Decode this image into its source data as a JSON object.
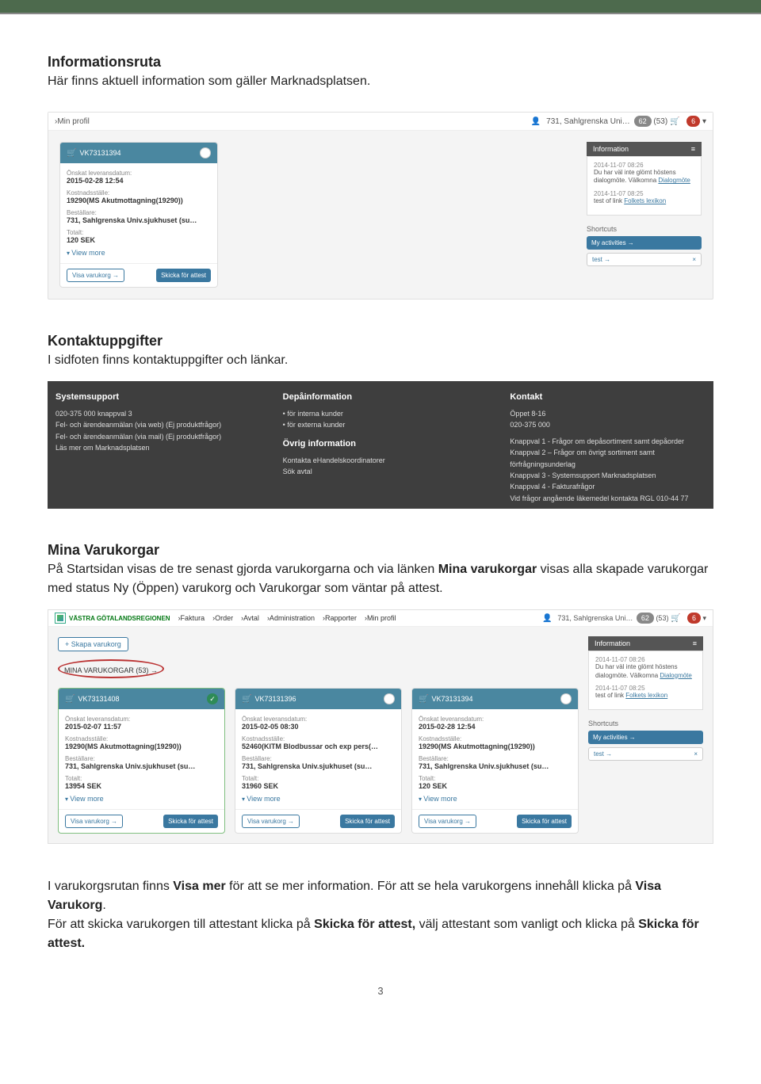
{
  "doc": {
    "h1": "Informationsruta",
    "p1": "Här finns aktuell information som gäller Marknadsplatsen.",
    "h2": "Kontaktuppgifter",
    "p2": "I sidfoten finns kontaktuppgifter och länkar.",
    "h3": "Mina Varukorgar",
    "p3a": "På Startsidan visas de tre senast gjorda varukorgarna och via länken ",
    "p3b": "Mina varukorgar",
    "p3c": " visas alla skapade varukorgar med status Ny (Öppen) varukorg och Varukorgar som väntar på attest.",
    "p4a": "I varukorgsrutan finns ",
    "p4b": "Visa mer",
    "p4c": " för att se mer information. För att se hela varukorgens innehåll klicka på ",
    "p4d": "Visa Varukorg",
    "p4e": ".",
    "p5a": "För att skicka varukorgen till attestant klicka på ",
    "p5b": "Skicka för attest,",
    "p5c": " välj attestant som vanligt och klicka på ",
    "p5d": "Skicka för attest.",
    "pagenum": "3"
  },
  "header": {
    "profile_tab": "›Min profil",
    "user": "731, Sahlgrenska Uni…",
    "badge1": "62",
    "count1": "(53)",
    "badge2": "6"
  },
  "card1": {
    "id": "VK73131394",
    "status": "open",
    "k1": "Önskat leveransdatum:",
    "v1": "2015-02-28 12:54",
    "k2": "Kostnadsställe:",
    "v2": "19290(MS Akutmottagning(19290))",
    "k3": "Beställare:",
    "v3": "731, Sahlgrenska Univ.sjukhuset (su…",
    "k4": "Totalt:",
    "v4": "120 SEK",
    "view_more": "View more",
    "visa": "Visa varukorg →",
    "skicka": "Skicka för attest"
  },
  "info": {
    "title": "Information",
    "icon": "≡",
    "date1": "2014-11-07 08:26",
    "txt1a": "Du har väl inte glömt höstens dialogmöte. Välkomna ",
    "txt1b": "Dialogmöte",
    "date2": "2014-11-07 08:25",
    "txt2a": "test of link ",
    "txt2b": "Folkets lexikon"
  },
  "shortcuts": {
    "title": "Shortcuts",
    "btn1": "My activities →",
    "btn2": "test →",
    "close": "×"
  },
  "footer": {
    "c1h": "Systemsupport",
    "c1l1": "020-375 000 knappval 3",
    "c1l2": "Fel- och ärendeanmälan (via web) (Ej produktfrågor)",
    "c1l3": "Fel- och ärendeanmälan (via mail) (Ej produktfrågor)",
    "c1l4": "Läs mer om Marknadsplatsen",
    "c2h": "Depåinformation",
    "c2l1": "för interna kunder",
    "c2l2": "för externa kunder",
    "c2h2": "Övrig information",
    "c2l3": "Kontakta eHandelskoordinatorer",
    "c2l4": "Sök avtal",
    "c3h": "Kontakt",
    "c3l1": "Öppet 8-16",
    "c3l2": "020-375 000",
    "c3l3": "Knappval 1 - Frågor om depåsortiment samt depåorder",
    "c3l4": "Knappval 2 – Frågor om övrigt sortiment samt förfrågningsunderlag",
    "c3l5": "Knappval 3 - Systemsupport Marknadsplatsen",
    "c3l6": "Knappval 4 - Fakturafrågor",
    "c3l7": "Vid frågor angående läkemedel kontakta RGL 010-44 77"
  },
  "nav": {
    "logo": "VÄSTRA GÖTALANDSREGIONEN",
    "tabs": [
      "›Faktura",
      "›Order",
      "›Avtal",
      "›Administration",
      "›Rapporter",
      "›Min profil"
    ]
  },
  "ss2": {
    "plus": "+ Skapa varukorg",
    "mina": "MINA VARUKORGAR (53) →"
  },
  "cards2": [
    {
      "id": "VK73131408",
      "status": "check",
      "k1": "Önskat leveransdatum:",
      "v1": "2015-02-07 11:57",
      "k2": "Kostnadsställe:",
      "v2": "19290(MS Akutmottagning(19290))",
      "k3": "Beställare:",
      "v3": "731, Sahlgrenska Univ.sjukhuset (su…",
      "k4": "Totalt:",
      "v4": "13954 SEK"
    },
    {
      "id": "VK73131396",
      "status": "open",
      "k1": "Önskat leveransdatum:",
      "v1": "2015-02-05 08:30",
      "k2": "Kostnadsställe:",
      "v2": "52460(KITM Blodbussar och exp pers(…",
      "k3": "Beställare:",
      "v3": "731, Sahlgrenska Univ.sjukhuset (su…",
      "k4": "Totalt:",
      "v4": "31960 SEK"
    },
    {
      "id": "VK73131394",
      "status": "open",
      "k1": "Önskat leveransdatum:",
      "v1": "2015-02-28 12:54",
      "k2": "Kostnadsställe:",
      "v2": "19290(MS Akutmottagning(19290))",
      "k3": "Beställare:",
      "v3": "731, Sahlgrenska Univ.sjukhuset (su…",
      "k4": "Totalt:",
      "v4": "120 SEK"
    }
  ]
}
